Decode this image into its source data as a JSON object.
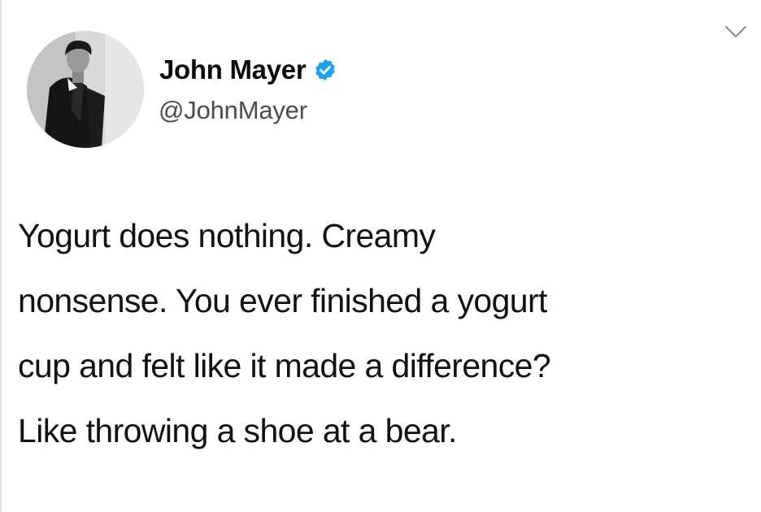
{
  "tweet": {
    "author": {
      "display_name": "John Mayer",
      "handle": "@JohnMayer",
      "verified": true,
      "avatar_icon": "person-photo-avatar"
    },
    "menu_icon": "chevron-down-icon",
    "text_lines": [
      "Yogurt does nothing. Creamy",
      "nonsense. You ever finished a yogurt",
      "cup and felt like it made a difference?",
      "Like throwing a shoe at a bear."
    ]
  },
  "colors": {
    "verified_badge": "#1da1f2",
    "text_primary": "#111111",
    "text_secondary": "#4b4b4b",
    "background": "#ffffff"
  }
}
